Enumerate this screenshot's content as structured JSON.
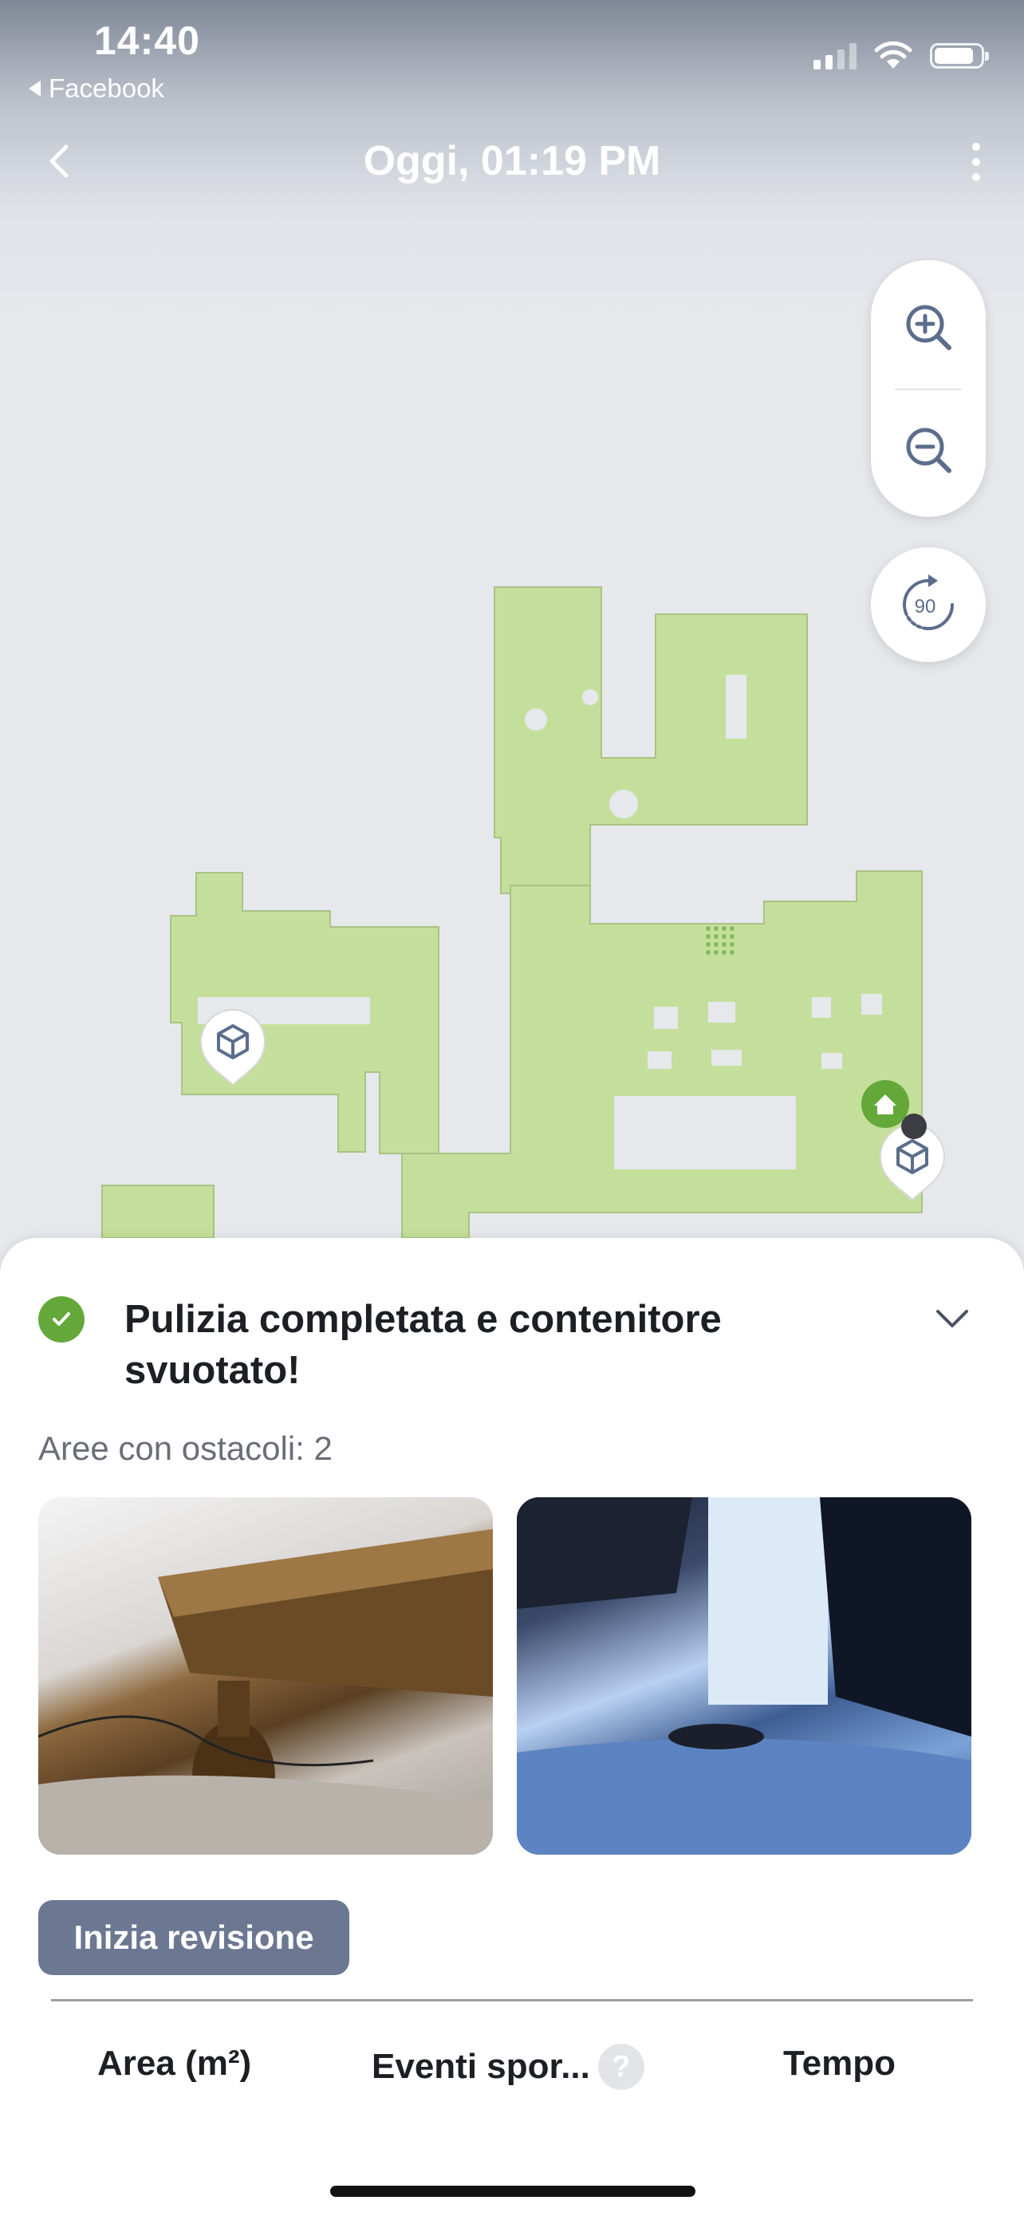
{
  "status_bar": {
    "time": "14:40",
    "back_app": "Facebook"
  },
  "header": {
    "title": "Oggi, 01:19 PM"
  },
  "map_controls": {
    "rotate_label": "90"
  },
  "sheet": {
    "status_title": "Pulizia completata e contenitore svuotato!",
    "obstacles_label": "Aree con ostacoli: 2",
    "review_button": "Inizia revisione",
    "stats": {
      "area": "Area (m²)",
      "events": "Eventi spor...",
      "events_help": "?",
      "time": "Tempo"
    }
  },
  "colors": {
    "map_fill": "#c4df9b",
    "accent_green": "#65a83a",
    "button": "#6c7892"
  },
  "icons": [
    "back-chevron-icon",
    "more-dots-icon",
    "zoom-in-icon",
    "zoom-out-icon",
    "rotate-icon",
    "obstacle-pin-icon",
    "home-dock-icon",
    "check-icon",
    "chevron-down-icon",
    "help-icon"
  ]
}
